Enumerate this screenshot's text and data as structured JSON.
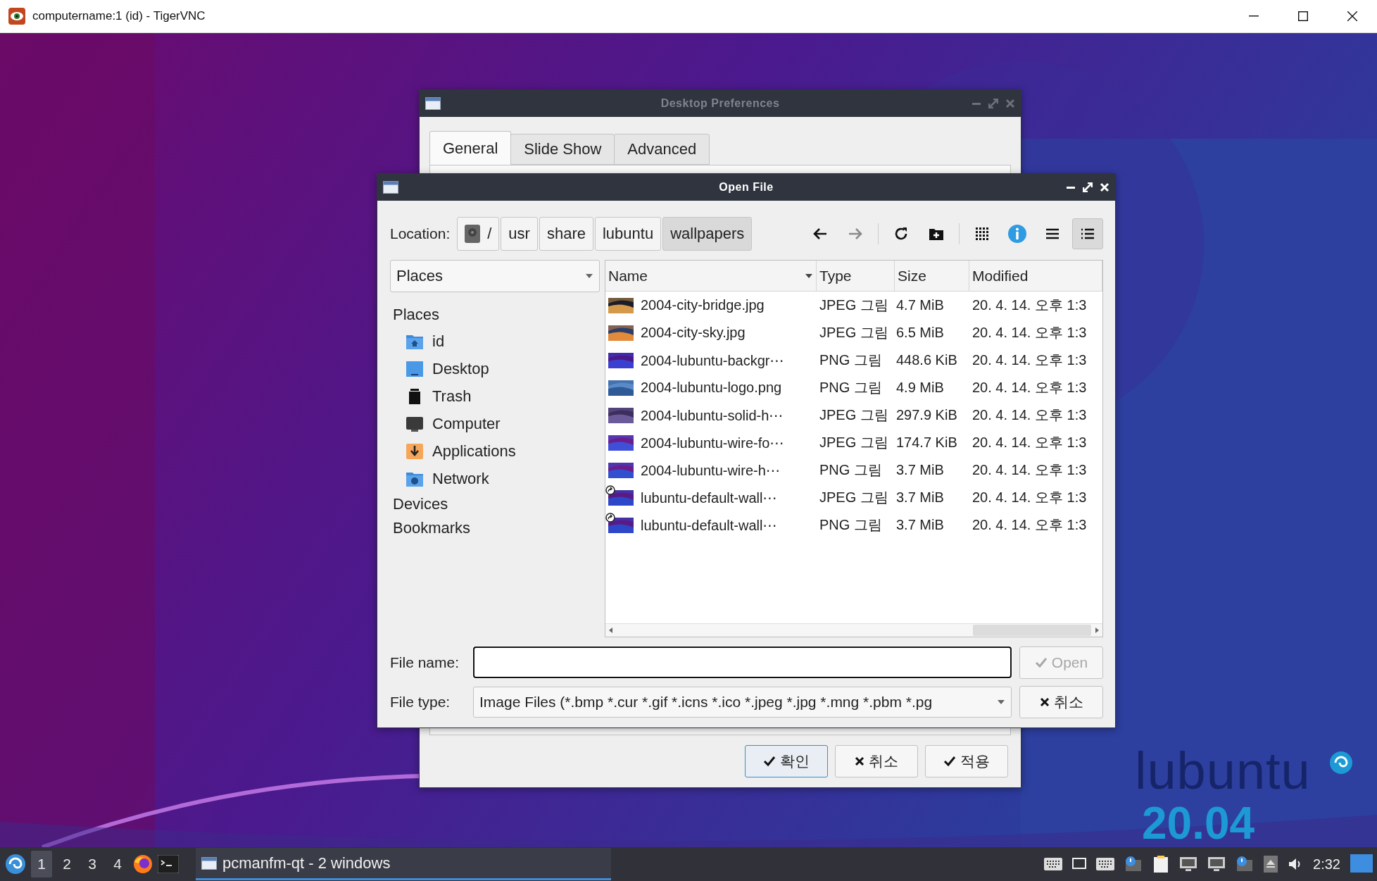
{
  "vnc_window": {
    "title": "computername:1 (id) - TigerVNC"
  },
  "desktop_preferences": {
    "title": "Desktop Preferences",
    "active": false,
    "tabs": [
      {
        "label": "General",
        "selected": true
      },
      {
        "label": "Slide Show",
        "selected": false
      },
      {
        "label": "Advanced",
        "selected": false
      }
    ],
    "buttons": [
      {
        "label": "확인",
        "kind": "check",
        "default": true
      },
      {
        "label": "취소",
        "kind": "cross",
        "default": false
      },
      {
        "label": "적용",
        "kind": "check",
        "default": false
      }
    ]
  },
  "open_file": {
    "title": "Open File",
    "active": true,
    "location_label": "Location:",
    "breadcrumbs": [
      {
        "label": "/",
        "kind": "drive",
        "selected": false
      },
      {
        "label": "usr",
        "kind": "folder",
        "selected": false
      },
      {
        "label": "share",
        "kind": "folder",
        "selected": false
      },
      {
        "label": "lubuntu",
        "kind": "folder",
        "selected": false
      },
      {
        "label": "wallpapers",
        "kind": "folder",
        "selected": true
      }
    ],
    "toolbar_groups": [
      {
        "buttons": [
          {
            "kind": "back",
            "disabled": false,
            "selected": false
          },
          {
            "kind": "forward",
            "disabled": true,
            "selected": false
          }
        ]
      },
      {
        "buttons": [
          {
            "kind": "reload",
            "disabled": false,
            "selected": false
          },
          {
            "kind": "new-folder",
            "disabled": false,
            "selected": false
          }
        ]
      },
      {
        "buttons": [
          {
            "kind": "icon-view",
            "disabled": false,
            "selected": false
          },
          {
            "kind": "info",
            "disabled": false,
            "selected": false
          },
          {
            "kind": "compact-view",
            "disabled": false,
            "selected": false
          },
          {
            "kind": "detail-view",
            "disabled": false,
            "selected": true
          }
        ]
      }
    ],
    "places_combo": "Places",
    "sidebar": [
      {
        "label": "Places",
        "children": [
          {
            "label": "id",
            "kind": "home"
          },
          {
            "label": "Desktop",
            "kind": "desktop"
          },
          {
            "label": "Trash",
            "kind": "trash"
          },
          {
            "label": "Computer",
            "kind": "computer"
          },
          {
            "label": "Applications",
            "kind": "applications"
          },
          {
            "label": "Network",
            "kind": "network"
          }
        ]
      },
      {
        "label": "Devices"
      },
      {
        "label": "Bookmarks"
      }
    ],
    "table": {
      "columns": [
        {
          "label": "Name",
          "sorted": true
        },
        {
          "label": "Type",
          "sorted": false
        },
        {
          "label": "Size",
          "sorted": false
        },
        {
          "label": "Modified",
          "sorted": false
        }
      ],
      "rows": [
        {
          "name": "2004-city-bridge.jpg",
          "type": "JPEG 그림",
          "size": "4.7 MiB",
          "modified": "20. 4. 14. 오후 1:3",
          "link": false
        },
        {
          "name": "2004-city-sky.jpg",
          "type": "JPEG 그림",
          "size": "6.5 MiB",
          "modified": "20. 4. 14. 오후 1:3",
          "link": false
        },
        {
          "name": "2004-lubuntu-backgr⋯",
          "type": "PNG 그림",
          "size": "448.6 KiB",
          "modified": "20. 4. 14. 오후 1:3",
          "link": false
        },
        {
          "name": "2004-lubuntu-logo.png",
          "type": "PNG 그림",
          "size": "4.9 MiB",
          "modified": "20. 4. 14. 오후 1:3",
          "link": false
        },
        {
          "name": "2004-lubuntu-solid-h⋯",
          "type": "JPEG 그림",
          "size": "297.9 KiB",
          "modified": "20. 4. 14. 오후 1:3",
          "link": false
        },
        {
          "name": "2004-lubuntu-wire-fo⋯",
          "type": "JPEG 그림",
          "size": "174.7 KiB",
          "modified": "20. 4. 14. 오후 1:3",
          "link": false
        },
        {
          "name": "2004-lubuntu-wire-h⋯",
          "type": "PNG 그림",
          "size": "3.7 MiB",
          "modified": "20. 4. 14. 오후 1:3",
          "link": false
        },
        {
          "name": "lubuntu-default-wall⋯",
          "type": "JPEG 그림",
          "size": "3.7 MiB",
          "modified": "20. 4. 14. 오후 1:3",
          "link": true
        },
        {
          "name": "lubuntu-default-wall⋯",
          "type": "PNG 그림",
          "size": "3.7 MiB",
          "modified": "20. 4. 14. 오후 1:3",
          "link": true
        }
      ]
    },
    "file_name_label": "File name:",
    "open_button": {
      "label": "Open",
      "disabled": true
    },
    "file_type_label": "File type:",
    "file_type_value": "Image Files (*.bmp *.cur *.gif *.icns *.ico *.jpeg *.jpg *.mng *.pbm *.pg",
    "cancel_button": "취소"
  },
  "wallpaper": {
    "kind": "picture",
    "logo_text": "lubuntu",
    "version": "20.04"
  },
  "taskbar": {
    "workspaces": [
      {
        "label": "1",
        "selected": true
      },
      {
        "label": "2",
        "selected": false
      },
      {
        "label": "3",
        "selected": false
      },
      {
        "label": "4",
        "selected": false
      }
    ],
    "tasks": [
      {
        "label": "pcmanfm-qt - 2 windows",
        "selected": true
      }
    ],
    "clock": "2:32"
  }
}
